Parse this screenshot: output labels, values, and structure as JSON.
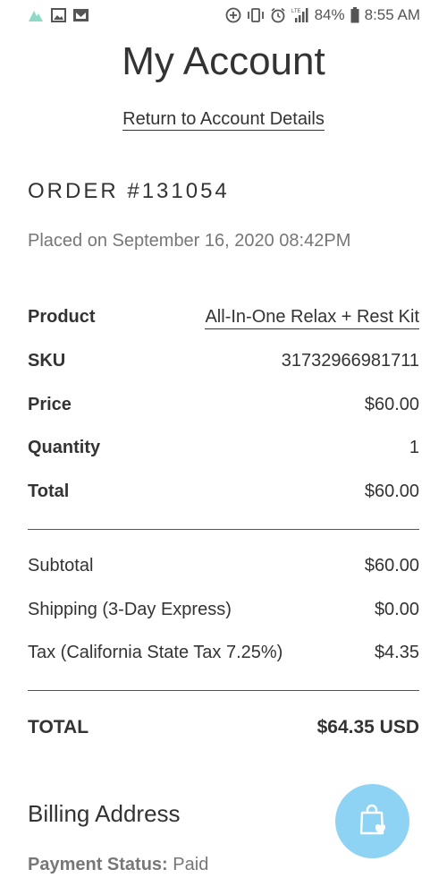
{
  "status_bar": {
    "battery": "84%",
    "time": "8:55 AM",
    "network": "LTE",
    "icons_left": [
      "app-logo-icon",
      "image-icon",
      "gmail-icon"
    ],
    "icons_right": [
      "data-saver-icon",
      "vibrate-icon",
      "alarm-icon",
      "signal-icon",
      "battery-icon"
    ]
  },
  "header": {
    "title": "My Account",
    "return_link": "Return to Account Details"
  },
  "order": {
    "number": "ORDER #131054",
    "placed_on": "Placed on September 16, 2020 08:42PM",
    "details": [
      {
        "label": "Product",
        "value": "All-In-One Relax + Rest Kit"
      },
      {
        "label": "SKU",
        "value": "31732966981711"
      },
      {
        "label": "Price",
        "value": "$60.00"
      },
      {
        "label": "Quantity",
        "value": "1"
      },
      {
        "label": "Total",
        "value": "$60.00"
      }
    ],
    "summary": [
      {
        "label": "Subtotal",
        "value": "$60.00"
      },
      {
        "label": "Shipping (3-Day Express)",
        "value": "$0.00"
      },
      {
        "label": "Tax (California State Tax 7.25%)",
        "value": "$4.35"
      }
    ],
    "grand_total": {
      "label": "TOTAL",
      "value": "$64.35 USD"
    }
  },
  "billing": {
    "heading": "Billing Address",
    "payment_status_label": "Payment Status:",
    "payment_status_value": "Paid"
  },
  "fab": {
    "icon": "shopping-bag-heart-icon",
    "color": "#8fd3f4"
  }
}
